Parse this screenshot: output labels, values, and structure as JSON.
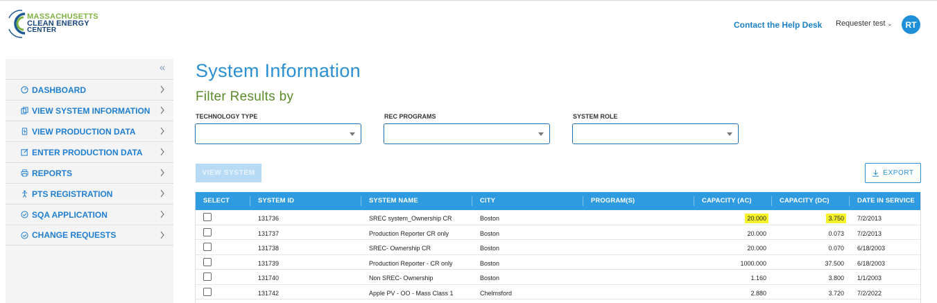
{
  "logo": {
    "line1": "MASSACHUSETTS",
    "line2": "CLEAN ENERGY",
    "line3": "CENTER",
    "mark": "C"
  },
  "header": {
    "help_link": "Contact the Help Desk",
    "user_name": "Requester test",
    "avatar_initials": "RT"
  },
  "sidebar": {
    "collapse_icon": "«",
    "items": [
      {
        "label": "DASHBOARD",
        "icon": "dashboard-icon"
      },
      {
        "label": "VIEW SYSTEM INFORMATION",
        "icon": "system-info-icon"
      },
      {
        "label": "VIEW PRODUCTION DATA",
        "icon": "production-data-icon"
      },
      {
        "label": "ENTER PRODUCTION DATA",
        "icon": "edit-icon"
      },
      {
        "label": "REPORTS",
        "icon": "print-icon"
      },
      {
        "label": "PTS REGISTRATION",
        "icon": "person-icon"
      },
      {
        "label": "SQA APPLICATION",
        "icon": "check-circle-icon"
      },
      {
        "label": "CHANGE REQUESTS",
        "icon": "check-circle-icon"
      }
    ]
  },
  "main": {
    "title": "System Information",
    "filter_title": "Filter Results by",
    "filters": [
      {
        "label": "TECHNOLOGY TYPE",
        "value": ""
      },
      {
        "label": "REC PROGRAMS",
        "value": ""
      },
      {
        "label": "SYSTEM ROLE",
        "value": ""
      }
    ],
    "view_button": "VIEW SYSTEM",
    "export_button": "EXPORT"
  },
  "table": {
    "headers": [
      "SELECT",
      "SYSTEM ID",
      "SYSTEM NAME",
      "CITY",
      "PROGRAM(S)",
      "CAPACITY (AC)",
      "CAPACITY (DC)",
      "DATE IN SERVICE"
    ],
    "rows": [
      {
        "id": "131736",
        "name": "SREC system_Ownership CR",
        "city": "Boston",
        "programs": "",
        "cap_ac": "20.000",
        "cap_dc": "3.750",
        "date": "7/2/2013"
      },
      {
        "id": "131737",
        "name": "Production Reporter CR only",
        "city": "Boston",
        "programs": "",
        "cap_ac": "20.000",
        "cap_dc": "0.073",
        "date": "7/2/2013"
      },
      {
        "id": "131738",
        "name": "SREC- Ownership CR",
        "city": "Boston",
        "programs": "",
        "cap_ac": "20.000",
        "cap_dc": "0.070",
        "date": "6/18/2003"
      },
      {
        "id": "131739",
        "name": "Production Reporter - CR only",
        "city": "Boston",
        "programs": "",
        "cap_ac": "1000.000",
        "cap_dc": "37.500",
        "date": "6/18/2003"
      },
      {
        "id": "131740",
        "name": "Non SREC- Ownership",
        "city": "Boston",
        "programs": "",
        "cap_ac": "1.160",
        "cap_dc": "3.800",
        "date": "1/1/2003"
      },
      {
        "id": "131742",
        "name": "Apple PV - OO - Mass Class 1",
        "city": "Chelmsford",
        "programs": "",
        "cap_ac": "2.880",
        "cap_dc": "3.720",
        "date": "7/2/2022"
      }
    ]
  },
  "colors": {
    "primary": "#2a8fd3",
    "header_bg": "#2e9ae0",
    "green": "#5b8a2b",
    "highlight": "#f6f22a"
  }
}
